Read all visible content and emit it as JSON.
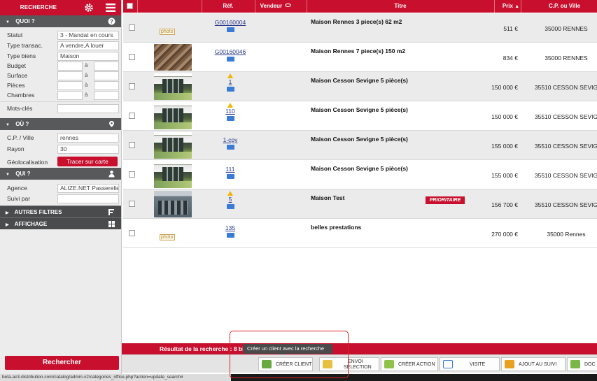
{
  "sidebar": {
    "title": "RECHERCHE",
    "sections": {
      "quoi": "QUOI ?",
      "ou": "OÙ ?",
      "qui": "QUI ?",
      "filtres": "AUTRES FILTRES",
      "affichage": "AFFICHAGE"
    },
    "fields": {
      "statut_label": "Statut",
      "statut_value": "3 - Mandat en cours",
      "type_transac_label": "Type transac.",
      "type_transac_value": "A vendre,A louer",
      "type_biens_label": "Type biens",
      "type_biens_value": "Maison",
      "budget_label": "Budget",
      "surface_label": "Surface",
      "pieces_label": "Pièces",
      "chambres_label": "Chambres",
      "range_sep": "à",
      "mots_cles_label": "Mots-clés",
      "cp_label": "C.P. / Ville",
      "cp_value": "rennes",
      "rayon_label": "Rayon",
      "rayon_value": "30",
      "geoloc_label": "Géolocalisation",
      "tracer_label": "Tracer sur carte",
      "agence_label": "Agence",
      "agence_value": "ALIZE.NET Passerelle",
      "suivi_label": "Suivi par"
    },
    "search_button": "Rechercher"
  },
  "table": {
    "headers": {
      "ref": "Réf.",
      "vendeur": "Vendeur",
      "titre": "Titre",
      "prix": "Prix",
      "cp": "C.P. ou Ville"
    },
    "rows": [
      {
        "ref": "G00160004",
        "titre": "Maison Rennes 3 piece(s) 62 m2",
        "prix": "511 €",
        "cp": "35000 RENNES"
      },
      {
        "ref": "G00160046",
        "titre": "Maison Rennes 7 piece(s) 150 m2",
        "prix": "834 €",
        "cp": "35000 RENNES"
      },
      {
        "ref": "1",
        "titre": "Maison Cesson Sevigne 5 pièce(s)",
        "prix": "150 000 €",
        "cp": "35510 CESSON SEVIG"
      },
      {
        "ref": "110",
        "titre": "Maison Cesson Sevigne 5 pièce(s)",
        "prix": "150 000 €",
        "cp": "35510 CESSON SEVIG"
      },
      {
        "ref": "1-cpy",
        "titre": "Maison Cesson Sevigne 5 pièce(s)",
        "prix": "155 000 €",
        "cp": "35510 CESSON SEVIG"
      },
      {
        "ref": "111",
        "titre": "Maison Cesson Sevigne 5 pièce(s)",
        "prix": "155 000 €",
        "cp": "35510 CESSON SEVIG"
      },
      {
        "ref": "5",
        "titre": "Maison Test",
        "badge": "PRIORITAIRE",
        "prix": "156 700 €",
        "cp": "35510 CESSON SEVIG"
      },
      {
        "ref": "135",
        "titre": "belles prestations",
        "prix": "270 000 €",
        "cp": "35000 Rennes"
      }
    ]
  },
  "result_text": "Résultat de la recherche : 8 bien",
  "tooltip": "Créer un client avec la recherche",
  "toolbar": {
    "creer_client": "CRÉER CLIENT",
    "envoi_l1": "ENVOI",
    "envoi_l2": "SÉLECTION",
    "creer_action": "CRÉER ACTION",
    "visite": "VISITE",
    "ajout_suivi": "AJOUT AU SUIVI",
    "doc": "DOC"
  },
  "status_url": "beta.ac3-distribution.com/catalog/admin-v2/categories_office.php?action=update_search#",
  "colors": {
    "accent": "#c8102e",
    "section": "#58595b"
  }
}
